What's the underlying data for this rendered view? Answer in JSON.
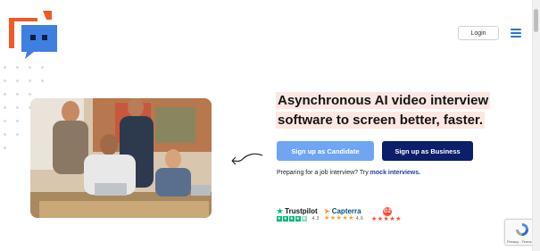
{
  "header": {
    "login_label": "Login",
    "brand_colors": {
      "orange": "#f05a28",
      "blue": "#3f7fe0"
    }
  },
  "hero": {
    "headline_line1": "Asynchronous AI video interview",
    "headline_line2": "software to screen better, faster.",
    "candidate_button": "Sign up as Candidate",
    "business_button": "Sign up as Business",
    "prep_text": "Preparing for a job interview? Try",
    "prep_link": "mock interviews.",
    "accent_highlight": "#fde7e2"
  },
  "reviews": [
    {
      "name": "Trustpilot",
      "rating": "4.3",
      "color": "#00b67a"
    },
    {
      "name": "Capterra",
      "rating": "4.6",
      "color": "#044d80"
    },
    {
      "name": "G2",
      "rating": "",
      "color": "#ff492c"
    }
  ],
  "recaptcha": {
    "terms": "Privacy - Terms"
  }
}
